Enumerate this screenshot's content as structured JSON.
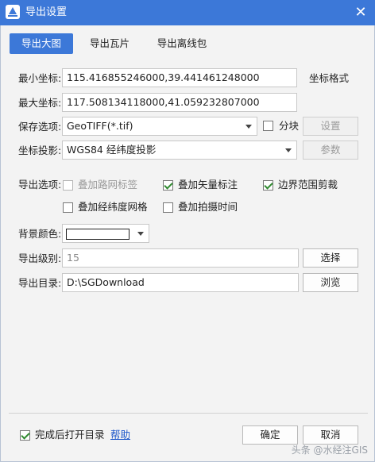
{
  "window": {
    "title": "导出设置",
    "close_label": "✕"
  },
  "tabs": [
    {
      "label": "导出大图",
      "active": true
    },
    {
      "label": "导出瓦片",
      "active": false
    },
    {
      "label": "导出离线包",
      "active": false
    }
  ],
  "coords": {
    "min_label": "最小坐标:",
    "min_value": "115.416855246000,39.441461248000",
    "max_label": "最大坐标:",
    "max_value": "117.508134118000,41.059232807000",
    "format_label": "坐标格式"
  },
  "save_option": {
    "label": "保存选项:",
    "selected": "GeoTIFF(*.tif)",
    "tile_label": "分块",
    "tile_checked": false,
    "settings_button": "设置"
  },
  "projection": {
    "label": "坐标投影:",
    "selected": "WGS84 经纬度投影",
    "params_button": "参数"
  },
  "export_options": {
    "label": "导出选项:",
    "items": [
      {
        "label": "叠加路网标签",
        "checked": false,
        "disabled": true
      },
      {
        "label": "叠加矢量标注",
        "checked": true,
        "disabled": false
      },
      {
        "label": "边界范围剪裁",
        "checked": true,
        "disabled": false
      },
      {
        "label": "叠加经纬度网格",
        "checked": false,
        "disabled": false
      },
      {
        "label": "叠加拍摄时间",
        "checked": false,
        "disabled": false
      }
    ]
  },
  "background": {
    "label": "背景颜色:",
    "color": "#ffffff"
  },
  "level": {
    "label": "导出级别:",
    "value": "15",
    "select_button": "选择"
  },
  "directory": {
    "label": "导出目录:",
    "value": "D:\\SGDownload",
    "browse_button": "浏览"
  },
  "footer": {
    "open_dir_label": "完成后打开目录",
    "open_dir_checked": true,
    "help_link": "帮助",
    "ok_button": "确定",
    "cancel_button": "取消"
  },
  "watermark": "头条 @水经注GIS",
  "colors": {
    "accent": "#3c78d8",
    "link": "#1a55c9",
    "check": "#2f8a2f"
  }
}
